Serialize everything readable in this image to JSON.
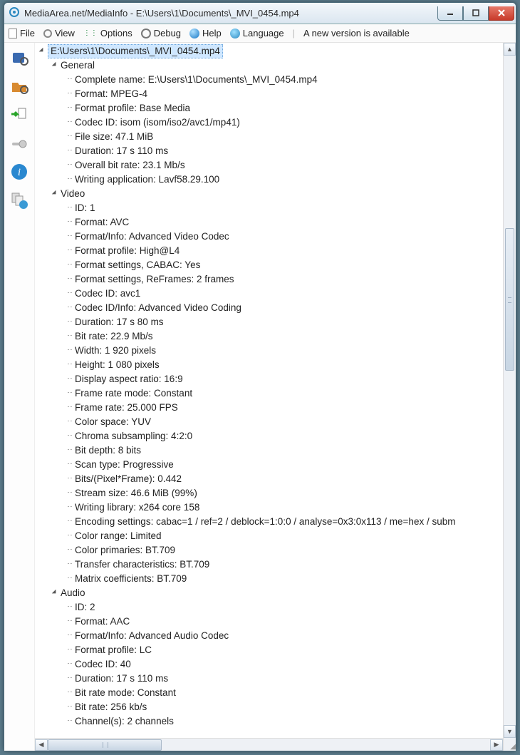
{
  "window": {
    "title": "MediaArea.net/MediaInfo - E:\\Users\\1\\Documents\\_MVI_0454.mp4"
  },
  "menu": {
    "file": "File",
    "view": "View",
    "options": "Options",
    "debug": "Debug",
    "help": "Help",
    "language": "Language",
    "version_note": "A new version is available"
  },
  "tree": {
    "file_path": "E:\\Users\\1\\Documents\\_MVI_0454.mp4",
    "sections": [
      {
        "name": "General",
        "items": [
          "Complete name: E:\\Users\\1\\Documents\\_MVI_0454.mp4",
          "Format: MPEG-4",
          "Format profile: Base Media",
          "Codec ID: isom (isom/iso2/avc1/mp41)",
          "File size: 47.1 MiB",
          "Duration: 17 s 110 ms",
          "Overall bit rate: 23.1 Mb/s",
          "Writing application: Lavf58.29.100"
        ]
      },
      {
        "name": "Video",
        "items": [
          "ID: 1",
          "Format: AVC",
          "Format/Info: Advanced Video Codec",
          "Format profile: High@L4",
          "Format settings, CABAC: Yes",
          "Format settings, ReFrames: 2 frames",
          "Codec ID: avc1",
          "Codec ID/Info: Advanced Video Coding",
          "Duration: 17 s 80 ms",
          "Bit rate: 22.9 Mb/s",
          "Width: 1 920 pixels",
          "Height: 1 080 pixels",
          "Display aspect ratio: 16:9",
          "Frame rate mode: Constant",
          "Frame rate: 25.000 FPS",
          "Color space: YUV",
          "Chroma subsampling: 4:2:0",
          "Bit depth: 8 bits",
          "Scan type: Progressive",
          "Bits/(Pixel*Frame): 0.442",
          "Stream size: 46.6 MiB (99%)",
          "Writing library: x264 core 158",
          "Encoding settings: cabac=1 / ref=2 / deblock=1:0:0 / analyse=0x3:0x113 / me=hex / subm",
          "Color range: Limited",
          "Color primaries: BT.709",
          "Transfer characteristics: BT.709",
          "Matrix coefficients: BT.709"
        ]
      },
      {
        "name": "Audio",
        "items": [
          "ID: 2",
          "Format: AAC",
          "Format/Info: Advanced Audio Codec",
          "Format profile: LC",
          "Codec ID: 40",
          "Duration: 17 s 110 ms",
          "Bit rate mode: Constant",
          "Bit rate: 256 kb/s",
          "Channel(s): 2 channels"
        ]
      }
    ]
  }
}
